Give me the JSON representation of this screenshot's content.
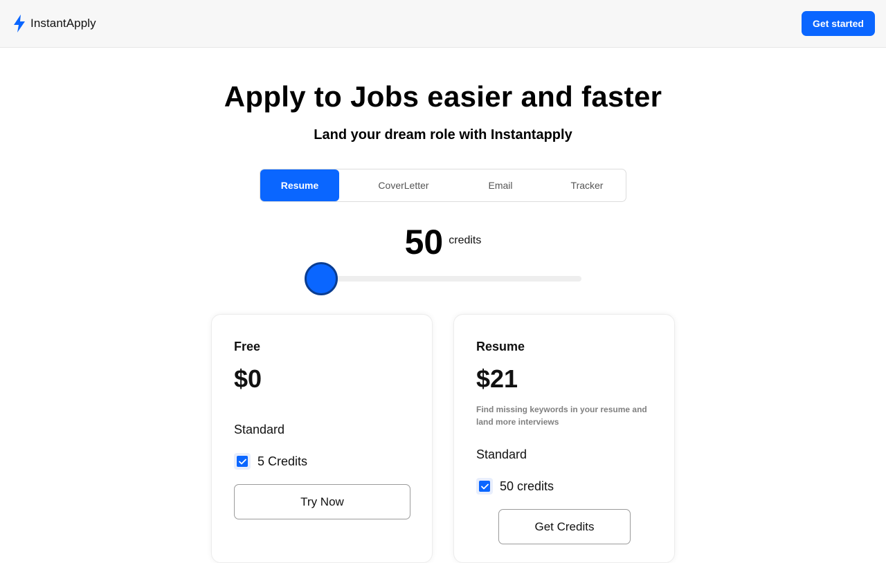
{
  "nav": {
    "brand_name": "InstantApply",
    "cta_label": "Get started",
    "brand_color": "#0a66ff"
  },
  "hero": {
    "title": "Apply to Jobs easier and faster",
    "subtitle": "Land your dream role with Instantapply"
  },
  "tabs": {
    "items": [
      {
        "label": "Resume",
        "active": true
      },
      {
        "label": "CoverLetter",
        "active": false
      },
      {
        "label": "Email",
        "active": false
      },
      {
        "label": "Tracker",
        "active": false
      }
    ]
  },
  "credits": {
    "amount": "50",
    "unit": "credits",
    "slider_fraction": 0.0
  },
  "plans": [
    {
      "name": "Free",
      "price": "$0",
      "description": "",
      "tier": "Standard",
      "feature": "5 Credits",
      "button_label": "Try Now"
    },
    {
      "name": "Resume",
      "price": "$21",
      "description": "Find missing keywords in your resume and land more interviews",
      "tier": "Standard",
      "feature": "50 credits",
      "button_label": "Get Credits"
    }
  ],
  "icons": {
    "brand": "lightning-bolt-icon",
    "check": "checkmark-icon"
  }
}
